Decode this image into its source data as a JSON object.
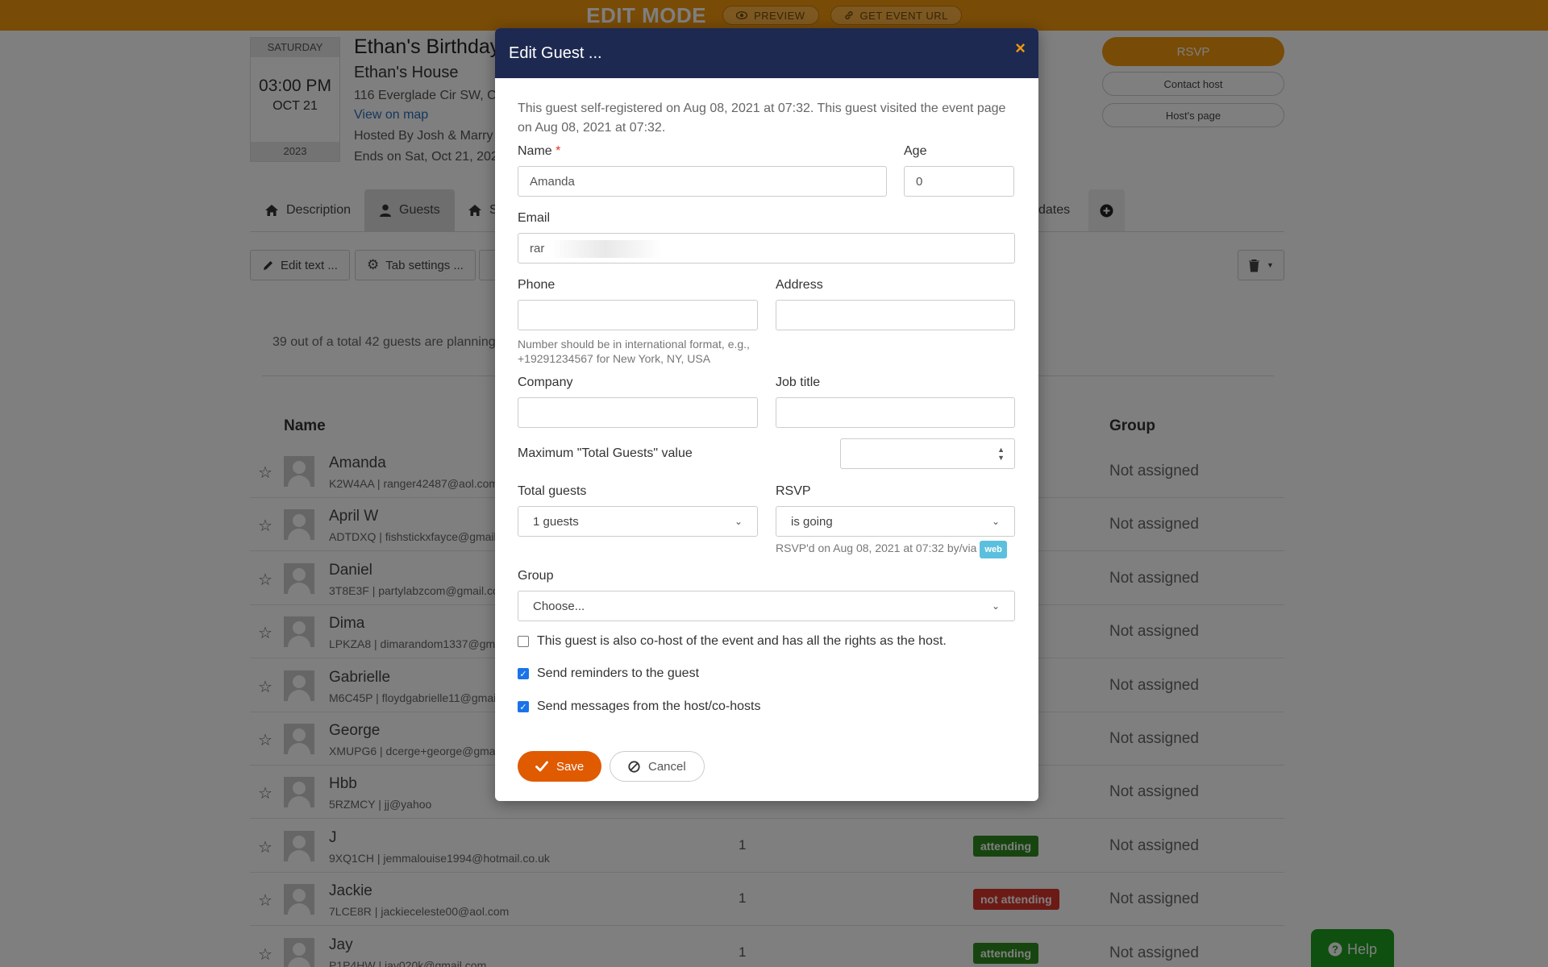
{
  "edit_bar": {
    "mode": "EDIT MODE",
    "preview": "PREVIEW",
    "get_url": "GET EVENT URL"
  },
  "event": {
    "weekday": "SATURDAY",
    "time": "03:00 PM",
    "day": "OCT 21",
    "year": "2023",
    "title": "Ethan's Birthday",
    "venue": "Ethan's House",
    "address": "116 Everglade Cir SW, Cal",
    "map_link": "View on map",
    "hosted_by": "Hosted By  Josh & Marry",
    "ends": "Ends on Sat, Oct 21, 2023"
  },
  "side": {
    "rsvp": "RSVP",
    "contact": "Contact host",
    "hosts_page": "Host's page"
  },
  "tabs": {
    "description": "Description",
    "guests": "Guests",
    "third": "S",
    "updates": "dates"
  },
  "toolbar": {
    "edit_text": "Edit text  ...",
    "tab_settings": "Tab settings  ..."
  },
  "guests_summary": "39 out of a total 42 guests are planning",
  "table": {
    "col_name": "Name",
    "col_group": "Group",
    "rows": [
      {
        "name": "Amanda",
        "sub": "K2W4AA | ranger42487@aol.com",
        "count": "",
        "status": "",
        "group": "Not assigned"
      },
      {
        "name": "April W",
        "sub": "ADTDXQ | fishstickxfayce@gmail.c",
        "count": "",
        "status": "",
        "group": "Not assigned"
      },
      {
        "name": "Daniel",
        "sub": "3T8E3F | partylabzcom@gmail.co",
        "count": "",
        "status": "",
        "group": "Not assigned"
      },
      {
        "name": "Dima",
        "sub": "LPKZA8 | dimarandom1337@gma",
        "count": "",
        "status": "",
        "group": "Not assigned"
      },
      {
        "name": "Gabrielle",
        "sub": "M6C45P | floydgabrielle11@gmail",
        "count": "",
        "status": "",
        "group": "Not assigned"
      },
      {
        "name": "George",
        "sub": "XMUPG6 | dcerge+george@gma",
        "count": "",
        "status": "",
        "group": "Not assigned"
      },
      {
        "name": "Hbb",
        "sub": "5RZMCY | jj@yahoo",
        "count": "",
        "status": "",
        "group": "Not assigned"
      },
      {
        "name": "J",
        "sub": "9XQ1CH | jemmalouise1994@hotmail.co.uk",
        "count": "1",
        "status": "attending",
        "group": "Not assigned"
      },
      {
        "name": "Jackie",
        "sub": "7LCE8R | jackieceleste00@aol.com",
        "count": "1",
        "status": "not attending",
        "group": "Not assigned"
      },
      {
        "name": "Jay",
        "sub": "P1P4HW | jay020k@gmail.com",
        "count": "1",
        "status": "attending",
        "group": "Not assigned"
      }
    ]
  },
  "help": "Help",
  "modal": {
    "title": "Edit Guest ...",
    "close": "×",
    "note": "This guest self-registered on Aug 08, 2021 at 07:32. This guest visited the event page on Aug 08, 2021 at 07:32.",
    "name_label": "Name",
    "name_required": "*",
    "name_value": "Amanda",
    "age_label": "Age",
    "age_value": "0",
    "email_label": "Email",
    "email_value": "rar",
    "phone_label": "Phone",
    "phone_value": "",
    "phone_hint": "Number should be in international format, e.g., +19291234567 for New York, NY, USA",
    "address_label": "Address",
    "address_value": "",
    "company_label": "Company",
    "company_value": "",
    "job_label": "Job title",
    "job_value": "",
    "max_label": "Maximum \"Total Guests\" value",
    "max_value": "",
    "total_label": "Total guests",
    "total_value": "1 guests",
    "rsvp_label": "RSVP",
    "rsvp_value": "is going",
    "rsvp_note": "RSVP'd on Aug 08, 2021 at 07:32 by/via",
    "rsvp_via": "web",
    "group_label": "Group",
    "group_value": "Choose...",
    "cohost_label": "This guest is also co-host of the event and has all the rights as the host.",
    "cohost_checked": false,
    "reminders_label": "Send reminders to the guest",
    "reminders_checked": true,
    "messages_label": "Send messages from the host/co-hosts",
    "messages_checked": true,
    "save": "Save",
    "cancel": "Cancel"
  },
  "colors": {
    "accent": "#f0960f",
    "modal_header": "#1d2951",
    "save": "#e05a00",
    "attending": "#2e8b1e",
    "not_attending": "#d9342b",
    "help": "#1e9e1e"
  },
  "icons": [
    "eye-icon",
    "link-icon",
    "home-icon",
    "user-icon",
    "plus-circle-icon",
    "pencil-icon",
    "gear-icon",
    "trash-icon",
    "star-icon",
    "question-icon",
    "check-icon",
    "ban-icon",
    "close-icon"
  ]
}
